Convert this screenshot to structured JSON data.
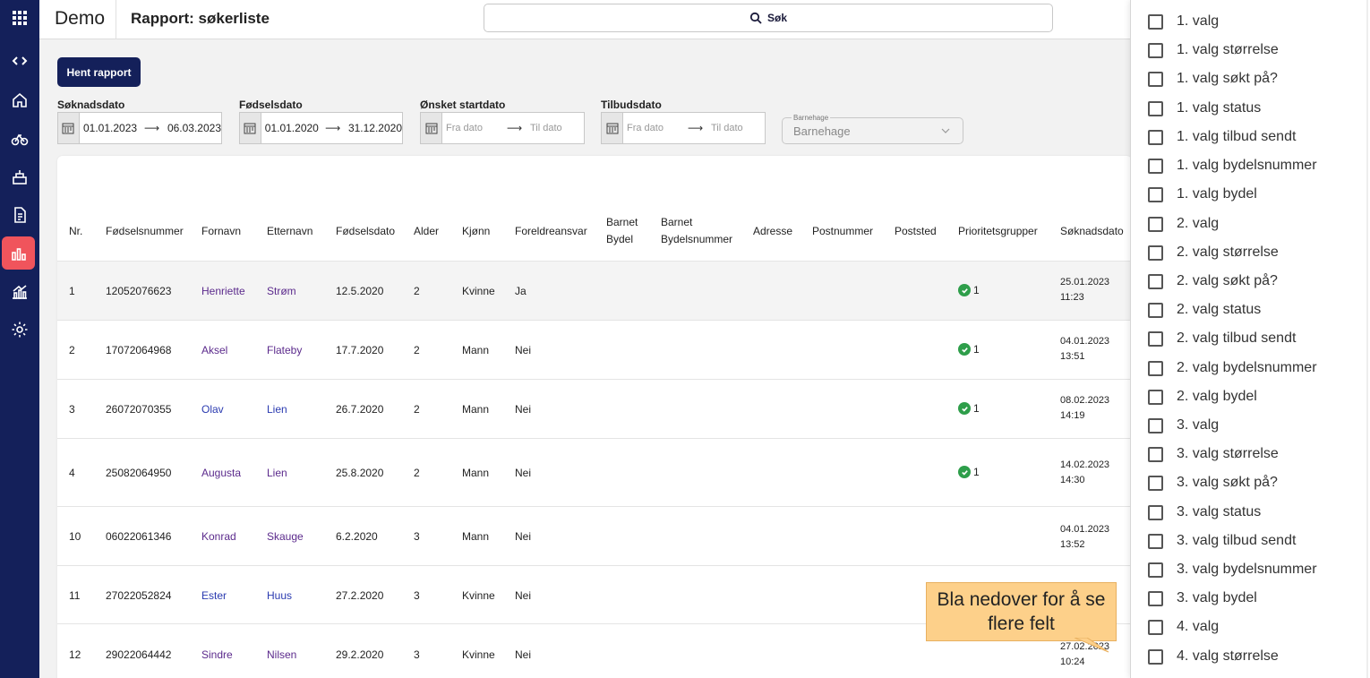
{
  "header": {
    "brand": "Demo",
    "page_title": "Rapport: søkerliste",
    "search_label": "Søk"
  },
  "rail": {
    "items": [
      {
        "name": "apps-grid-icon"
      },
      {
        "name": "code-icon"
      },
      {
        "name": "home-icon"
      },
      {
        "name": "bike-icon"
      },
      {
        "name": "building-icon"
      },
      {
        "name": "document-icon"
      },
      {
        "name": "bar-chart-icon",
        "active": true
      },
      {
        "name": "analytics-icon"
      },
      {
        "name": "settings-icon"
      }
    ]
  },
  "toolbar": {
    "fetch_label": "Hent rapport",
    "filters": [
      {
        "label": "Søknadsdato",
        "from": "01.01.2023",
        "to": "06.03.2023",
        "placeholder": false
      },
      {
        "label": "Fødselsdato",
        "from": "01.01.2020",
        "to": "31.12.2020",
        "placeholder": false
      },
      {
        "label": "Ønsket startdato",
        "from": "Fra dato",
        "to": "Til dato",
        "placeholder": true
      },
      {
        "label": "Tilbudsdato",
        "from": "Fra dato",
        "to": "Til dato",
        "placeholder": true
      }
    ],
    "kindergarten": {
      "label": "Barnehage",
      "value": "Barnehage"
    }
  },
  "table": {
    "columns": [
      "Nr.",
      "Fødselsnummer",
      "Fornavn",
      "Etternavn",
      "Fødselsdato",
      "Alder",
      "Kjønn",
      "Foreldreansvar",
      "Barnet Bydel",
      "Barnet Bydelsnummer",
      "Adresse",
      "Postnummer",
      "Poststed",
      "Prioritetsgrupper",
      "Søknadsdato"
    ],
    "rows": [
      {
        "nr": "1",
        "fnr": "12052076623",
        "first": "Henriette",
        "last": "Strøm",
        "dob": "12.5.2020",
        "age": "2",
        "sex": "Kvinne",
        "custody": "Ja",
        "prio": "1",
        "applied_date": "25.01.2023",
        "applied_time": "11:23"
      },
      {
        "nr": "2",
        "fnr": "17072064968",
        "first": "Aksel",
        "last": "Flateby",
        "dob": "17.7.2020",
        "age": "2",
        "sex": "Mann",
        "custody": "Nei",
        "prio": "1",
        "applied_date": "04.01.2023",
        "applied_time": "13:51"
      },
      {
        "nr": "3",
        "fnr": "26072070355",
        "first": "Olav",
        "last": "Lien",
        "dob": "26.7.2020",
        "age": "2",
        "sex": "Mann",
        "custody": "Nei",
        "prio": "1",
        "applied_date": "08.02.2023",
        "applied_time": "14:19"
      },
      {
        "nr": "4",
        "fnr": "25082064950",
        "first": "Augusta",
        "last": "Lien",
        "dob": "25.8.2020",
        "age": "2",
        "sex": "Mann",
        "custody": "Nei",
        "prio": "1",
        "applied_date": "14.02.2023",
        "applied_time": "14:30"
      },
      {
        "nr": "10",
        "fnr": "06022061346",
        "first": "Konrad",
        "last": "Skauge",
        "dob": "6.2.2020",
        "age": "3",
        "sex": "Mann",
        "custody": "Nei",
        "prio": "",
        "applied_date": "04.01.2023",
        "applied_time": "13:52"
      },
      {
        "nr": "11",
        "fnr": "27022052824",
        "first": "Ester",
        "last": "Huus",
        "dob": "27.2.2020",
        "age": "3",
        "sex": "Kvinne",
        "custody": "Nei",
        "prio": "",
        "applied_date": "",
        "applied_time": ""
      },
      {
        "nr": "12",
        "fnr": "29022064442",
        "first": "Sindre",
        "last": "Nilsen",
        "dob": "29.2.2020",
        "age": "3",
        "sex": "Kvinne",
        "custody": "Nei",
        "prio": "",
        "applied_date": "27.02.2023",
        "applied_time": "10:24"
      }
    ]
  },
  "tooltip": {
    "text": "Bla nedover for å se flere felt"
  },
  "column_picker": {
    "options": [
      "1. valg",
      "1. valg størrelse",
      "1. valg søkt på?",
      "1. valg status",
      "1. valg tilbud sendt",
      "1. valg bydelsnummer",
      "1. valg bydel",
      "2. valg",
      "2. valg størrelse",
      "2. valg søkt på?",
      "2. valg status",
      "2. valg tilbud sendt",
      "2. valg bydelsnummer",
      "2. valg bydel",
      "3. valg",
      "3. valg størrelse",
      "3. valg søkt på?",
      "3. valg status",
      "3. valg tilbud sendt",
      "3. valg bydelsnummer",
      "3. valg bydel",
      "4. valg",
      "4. valg størrelse"
    ]
  }
}
